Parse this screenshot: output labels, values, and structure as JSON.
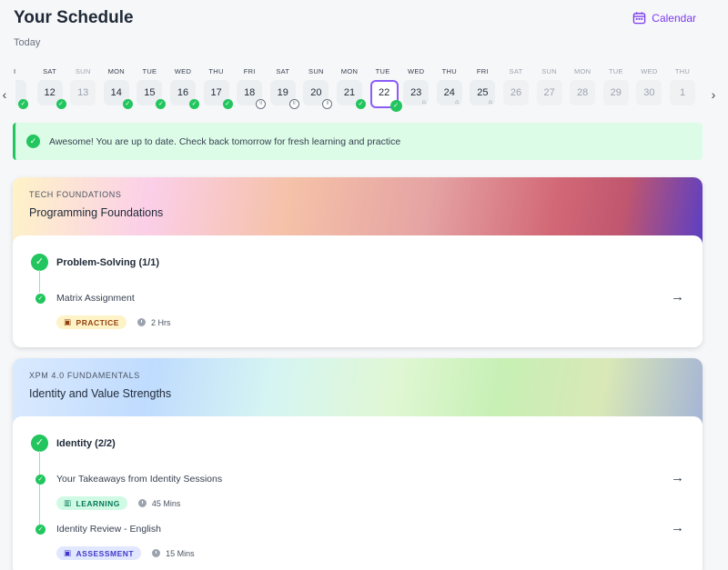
{
  "header": {
    "title": "Your Schedule",
    "subtitle": "Today",
    "calendar_label": "Calendar"
  },
  "nav": {
    "prev": "‹",
    "next": "›"
  },
  "days": [
    {
      "name": "I",
      "num": "",
      "status": "done",
      "state": "past"
    },
    {
      "name": "SAT",
      "num": "12",
      "status": "done",
      "state": "past"
    },
    {
      "name": "SUN",
      "num": "13",
      "status": "",
      "state": "future"
    },
    {
      "name": "MON",
      "num": "14",
      "status": "done",
      "state": "past"
    },
    {
      "name": "TUE",
      "num": "15",
      "status": "done",
      "state": "past"
    },
    {
      "name": "WED",
      "num": "16",
      "status": "done",
      "state": "past"
    },
    {
      "name": "THU",
      "num": "17",
      "status": "done",
      "state": "past"
    },
    {
      "name": "FRI",
      "num": "18",
      "status": "pause",
      "state": "past"
    },
    {
      "name": "SAT",
      "num": "19",
      "status": "pause",
      "state": "past"
    },
    {
      "name": "SUN",
      "num": "20",
      "status": "pause",
      "state": "past"
    },
    {
      "name": "MON",
      "num": "21",
      "status": "done",
      "state": "past"
    },
    {
      "name": "TUE",
      "num": "22",
      "status": "done",
      "state": "selected"
    },
    {
      "name": "WED",
      "num": "23",
      "status": "lock",
      "state": "past"
    },
    {
      "name": "THU",
      "num": "24",
      "status": "lock",
      "state": "past"
    },
    {
      "name": "FRI",
      "num": "25",
      "status": "lock",
      "state": "past"
    },
    {
      "name": "SAT",
      "num": "26",
      "status": "",
      "state": "future"
    },
    {
      "name": "SUN",
      "num": "27",
      "status": "",
      "state": "future"
    },
    {
      "name": "MON",
      "num": "28",
      "status": "",
      "state": "future"
    },
    {
      "name": "TUE",
      "num": "29",
      "status": "",
      "state": "future"
    },
    {
      "name": "WED",
      "num": "30",
      "status": "",
      "state": "future"
    },
    {
      "name": "THU",
      "num": "1",
      "status": "",
      "state": "future"
    }
  ],
  "banner": {
    "text": "Awesome! You are up to date. Check back tomorrow for fresh learning and practice"
  },
  "courses": [
    {
      "category": "TECH FOUNDATIONS",
      "name": "Programming Foundations",
      "module": "Problem-Solving (1/1)",
      "tasks": [
        {
          "name": "Matrix Assignment",
          "tag": "PRACTICE",
          "duration": "2 Hrs"
        }
      ]
    },
    {
      "category": "XPM 4.0 FUNDAMENTALS",
      "name": "Identity and Value Strengths",
      "module": "Identity (2/2)",
      "tasks": [
        {
          "name": "Your Takeaways from Identity Sessions",
          "tag": "LEARNING",
          "duration": "45 Mins"
        },
        {
          "name": "Identity Review - English",
          "tag": "ASSESSMENT",
          "duration": "15 Mins"
        }
      ]
    }
  ],
  "colors": {
    "accent": "#7c3aed",
    "success": "#22c55e",
    "banner_bg": "#dcfce7"
  }
}
